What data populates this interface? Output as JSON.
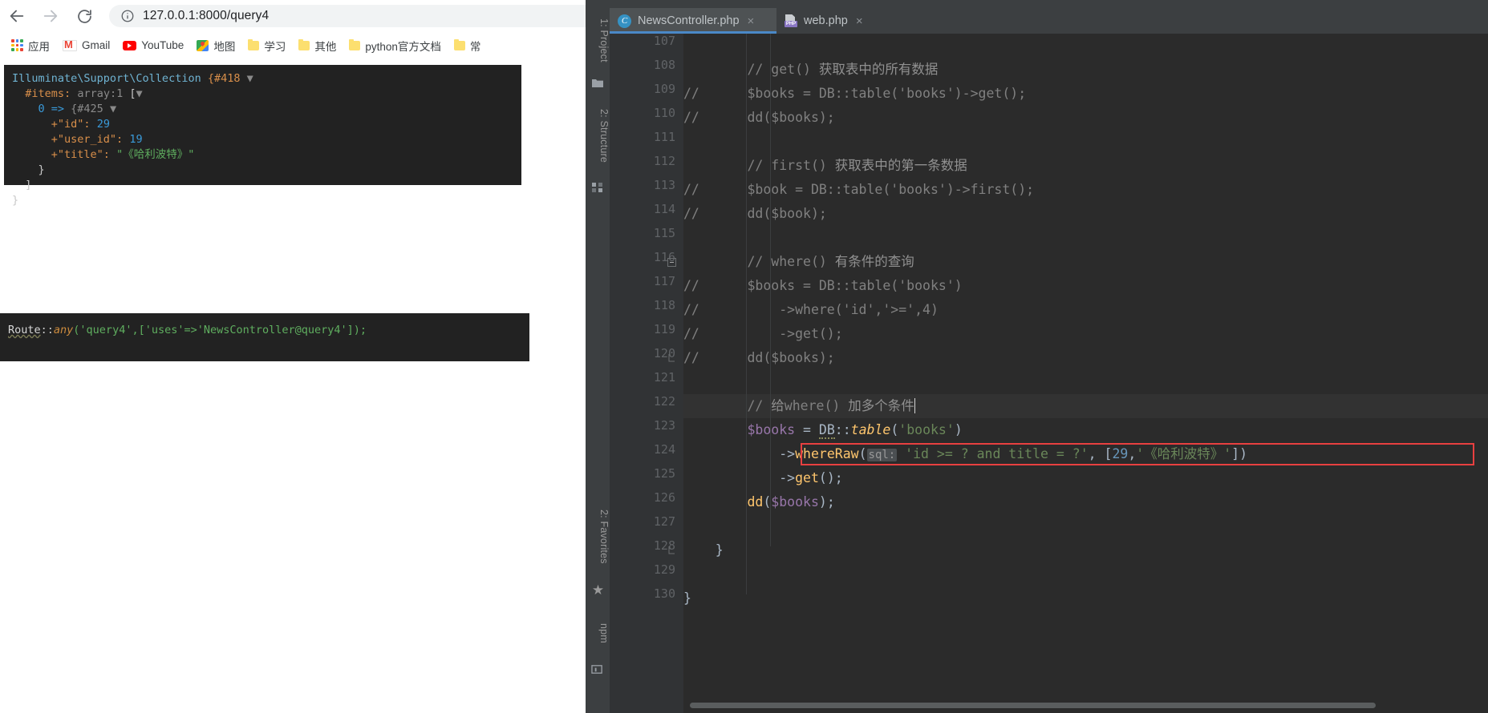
{
  "browser": {
    "nav": {
      "back_icon": "arrow-left-icon",
      "forward_icon": "arrow-right-icon",
      "reload_icon": "reload-icon",
      "info_icon": "page-info-icon",
      "url": "127.0.0.1:8000/query4"
    },
    "bookmarks": [
      {
        "label": "应用",
        "icon": "apps-grid-icon"
      },
      {
        "label": "Gmail",
        "icon": "gmail-icon"
      },
      {
        "label": "YouTube",
        "icon": "youtube-icon"
      },
      {
        "label": "地图",
        "icon": "maps-icon"
      },
      {
        "label": "学习",
        "icon": "folder-icon"
      },
      {
        "label": "其他",
        "icon": "folder-icon"
      },
      {
        "label": "python官方文档",
        "icon": "folder-icon"
      },
      {
        "label": "常",
        "icon": "folder-icon"
      }
    ],
    "dump_output": {
      "line1_class": "Illuminate\\Support\\Collection",
      "line1_brace": "{#418",
      "line2_key": "#items:",
      "line2_type": "array:1",
      "line3_index": "0 =>",
      "line3_brace": "{#425",
      "items": [
        {
          "key": "+\"id\":",
          "value": "29",
          "kind": "num"
        },
        {
          "key": "+\"user_id\":",
          "value": "19",
          "kind": "num"
        },
        {
          "key": "+\"title\":",
          "value": "\"《哈利波特》\"",
          "kind": "str"
        }
      ],
      "close1": "]",
      "close2": "}"
    },
    "route_snippet": {
      "prefix": "Route",
      "sep": "::",
      "method": "any",
      "rest": "('query4',['uses'=>'NewsController@query4']);"
    }
  },
  "ide": {
    "tool_windows": {
      "project": "1: Project",
      "structure": "2: Structure",
      "favorites": "2: Favorites",
      "npm": "npm"
    },
    "tabs": [
      {
        "label": "NewsController.php",
        "icon": "php-class-icon",
        "active": true,
        "close": "×"
      },
      {
        "label": "web.php",
        "icon": "php-file-icon",
        "active": false,
        "close": "×"
      }
    ],
    "editor": {
      "first_line": 107,
      "current_line": 122,
      "lines": [
        {
          "n": 107,
          "html": ""
        },
        {
          "n": 108,
          "html": "<span class='cm'>        // get() </span><span class='cm-cn'>获取表中的所有数据</span>"
        },
        {
          "n": 109,
          "html": "<span class='cm'>//      $books = DB::table('books')->get();</span>"
        },
        {
          "n": 110,
          "html": "<span class='cm'>//      dd($books);</span>"
        },
        {
          "n": 111,
          "html": ""
        },
        {
          "n": 112,
          "html": "<span class='cm'>        // first() </span><span class='cm-cn'>获取表中的第一条数据</span>"
        },
        {
          "n": 113,
          "html": "<span class='cm'>//      $book = DB::table('books')->first();</span>"
        },
        {
          "n": 114,
          "html": "<span class='cm'>//      dd($book);</span>"
        },
        {
          "n": 115,
          "html": ""
        },
        {
          "n": 116,
          "html": "<span class='cm'>        // where() </span><span class='cm-cn'>有条件的查询</span>"
        },
        {
          "n": 117,
          "html": "<span class='cm'>//      $books = DB::table('books')</span>"
        },
        {
          "n": 118,
          "html": "<span class='cm'>//          -&gt;where('id','&gt;=',4)</span>"
        },
        {
          "n": 119,
          "html": "<span class='cm'>//          -&gt;get();</span>"
        },
        {
          "n": 120,
          "html": "<span class='cm'>//      dd($books);</span>"
        },
        {
          "n": 121,
          "html": ""
        },
        {
          "n": 122,
          "html": "<span class='cm'>        // </span><span class='cm-cn'>给</span><span class='cm'>where() </span><span class='cm-cn'>加多个条件</span><span class='caret'></span>"
        },
        {
          "n": 123,
          "html": "        <span class='var'>$books</span> <span class='op'>=</span> <span class='cls2 wavy'>DB</span><span class='op'>::</span><span class='fn-i'>table</span><span class='op'>(</span><span class='str'>'books'</span><span class='op'>)</span>"
        },
        {
          "n": 124,
          "html": "            <span class='op'>-&gt;</span><span class='fn'>whereRaw</span><span class='op'>(</span><span class='hint'>sql:</span> <span class='str'>'id &gt;= ? and title = ?'</span><span class='comma op'>,</span> <span class='op'>[</span><span class='num'>29</span><span class='comma op'>,</span><span class='str'>'《哈利波特》'</span><span class='op'>])</span>"
        },
        {
          "n": 125,
          "html": "            <span class='op'>-&gt;</span><span class='fn'>get</span><span class='op'>();</span>"
        },
        {
          "n": 126,
          "html": "        <span class='fn'>dd</span><span class='op'>(</span><span class='var'>$books</span><span class='op'>);</span>"
        },
        {
          "n": 127,
          "html": ""
        },
        {
          "n": 128,
          "html": "    <span class='op'>}</span>"
        },
        {
          "n": 129,
          "html": ""
        },
        {
          "n": 130,
          "html": "<span class='op'>}</span>"
        }
      ]
    },
    "colors": {
      "editor_bg": "#2b2b2b",
      "gutter_bg": "#313335",
      "chrome_bg": "#3c3f41",
      "accent_tab": "#4a88c7",
      "error_box": "#e84040",
      "string": "#6a8759",
      "comment": "#808080",
      "function": "#ffc66d",
      "variable": "#9876aa",
      "number": "#6897bb"
    }
  }
}
